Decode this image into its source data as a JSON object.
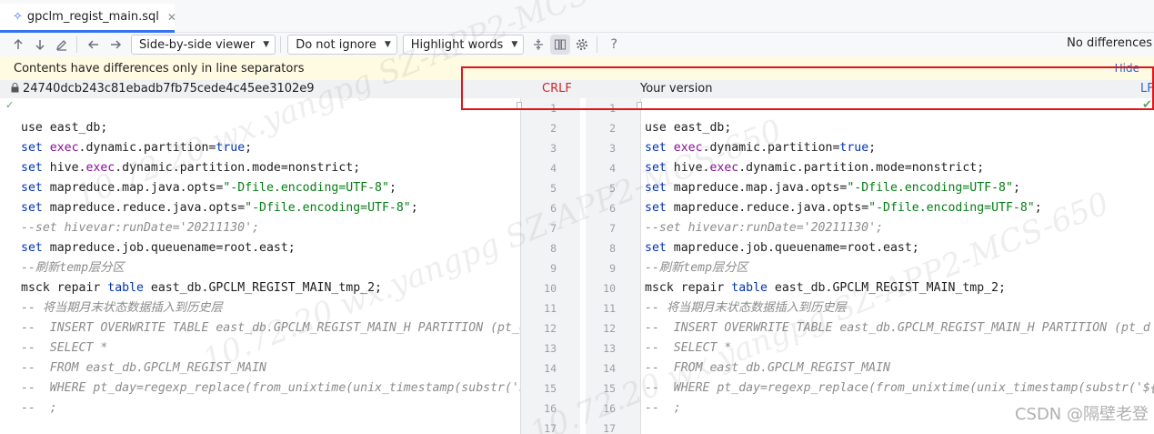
{
  "tab": {
    "file_icon": "✧",
    "name": "gpclm_regist_main.sql",
    "close": "✕"
  },
  "toolbar": {
    "viewer": "Side-by-side viewer",
    "ignore": "Do not ignore",
    "highlight": "Highlight words",
    "help": "?",
    "status": "No differences"
  },
  "notice": {
    "message": "Contents have differences only in line separators",
    "hide": "Hide"
  },
  "header": {
    "revision": "24740dcb243c81ebadb7fb75cede4c45ee3102e9",
    "left_separator": "CRLF",
    "right_title": "Your version",
    "right_separator": "LF"
  },
  "line_numbers": [
    "1",
    "2",
    "3",
    "4",
    "5",
    "6",
    "7",
    "8",
    "9",
    "10",
    "11",
    "12",
    "13",
    "14",
    "15",
    "16",
    "17"
  ],
  "code_lines": [
    [],
    [
      {
        "t": "use east_db;",
        "c": "txt"
      }
    ],
    [
      {
        "t": "set",
        "c": "kw"
      },
      {
        "t": " ",
        "c": "txt"
      },
      {
        "t": "exec",
        "c": "hl"
      },
      {
        "t": ".dynamic.partition=",
        "c": "txt"
      },
      {
        "t": "true",
        "c": "kw"
      },
      {
        "t": ";",
        "c": "txt"
      }
    ],
    [
      {
        "t": "set",
        "c": "kw"
      },
      {
        "t": " hive.",
        "c": "txt"
      },
      {
        "t": "exec",
        "c": "hl"
      },
      {
        "t": ".dynamic.partition.mode=nonstrict;",
        "c": "txt"
      }
    ],
    [
      {
        "t": "set",
        "c": "kw"
      },
      {
        "t": " mapreduce.map.java.opts=",
        "c": "txt"
      },
      {
        "t": "\"-Dfile.encoding=UTF-8\"",
        "c": "str"
      },
      {
        "t": ";",
        "c": "txt"
      }
    ],
    [
      {
        "t": "set",
        "c": "kw"
      },
      {
        "t": " mapreduce.reduce.java.opts=",
        "c": "txt"
      },
      {
        "t": "\"-Dfile.encoding=UTF-8\"",
        "c": "str"
      },
      {
        "t": ";",
        "c": "txt"
      }
    ],
    [
      {
        "t": "--set hivevar:runDate='20211130';",
        "c": "cmt"
      }
    ],
    [
      {
        "t": "set",
        "c": "kw"
      },
      {
        "t": " mapreduce.job.queuename=root.east;",
        "c": "txt"
      }
    ],
    [
      {
        "t": "--刷新temp层分区",
        "c": "cmt"
      }
    ],
    [
      {
        "t": "msck repair ",
        "c": "txt"
      },
      {
        "t": "table",
        "c": "kw"
      },
      {
        "t": " east_db.GPCLM_REGIST_MAIN_tmp_2;",
        "c": "txt"
      }
    ],
    [
      {
        "t": "-- 将当期月末状态数据插入到历史层",
        "c": "cmt"
      }
    ],
    [
      {
        "t": "--  INSERT OVERWRITE TABLE east_db.GPCLM_REGIST_MAIN_H PARTITION (pt_d",
        "c": "cmt"
      }
    ],
    [
      {
        "t": "--  SELECT *",
        "c": "cmt"
      }
    ],
    [
      {
        "t": "--  FROM east_db.GPCLM_REGIST_MAIN",
        "c": "cmt"
      }
    ],
    [
      {
        "t": "--  WHERE pt_day=regexp_replace(from_unixtime(unix_timestamp(substr('${",
        "c": "cmt"
      }
    ],
    [
      {
        "t": "--  ;",
        "c": "cmt"
      }
    ],
    []
  ],
  "watermark": {
    "line1": "10.72.20 wx.yangpg SZ-APP2-MCS-650",
    "line2": "10.72.20 wx.yangpg SZ-APP2-MCS-650",
    "line3": "10.72.20 wx.yangpg SZ-APP2-MCS-650"
  },
  "csdn_watermark": "CSDN @隔壁老登"
}
